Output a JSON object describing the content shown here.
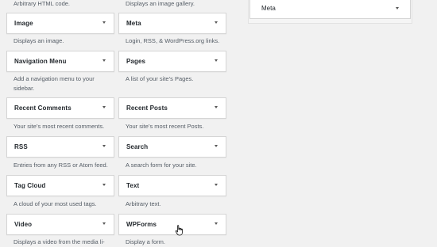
{
  "top_descriptions": {
    "left": "Arbitrary HTML code.",
    "right": "Displays an image gallery."
  },
  "widgets": [
    {
      "title": "Image",
      "description": "Displays an image."
    },
    {
      "title": "Meta",
      "description": "Login, RSS, & WordPress.org links."
    },
    {
      "title": "Navigation Menu",
      "description": "Add a navigation menu to your sidebar."
    },
    {
      "title": "Pages",
      "description": "A list of your site’s Pages."
    },
    {
      "title": "Recent Comments",
      "description": "Your site’s most recent comments."
    },
    {
      "title": "Recent Posts",
      "description": "Your site’s most recent Posts."
    },
    {
      "title": "RSS",
      "description": "Entries from any RSS or Atom feed."
    },
    {
      "title": "Search",
      "description": "A search form for your site."
    },
    {
      "title": "Tag Cloud",
      "description": "A cloud of your most used tags."
    },
    {
      "title": "Text",
      "description": "Arbitrary text."
    },
    {
      "title": "Video",
      "description": "Displays a video from the media li-"
    },
    {
      "title": "WPForms",
      "description": "Display a form."
    }
  ],
  "sidebar": {
    "widget_title": "Meta"
  }
}
